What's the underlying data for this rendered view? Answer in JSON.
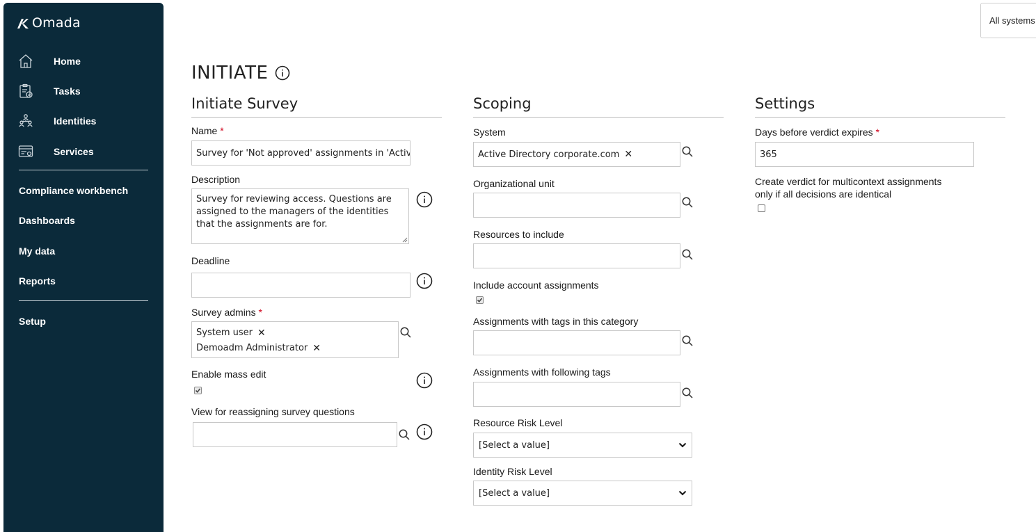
{
  "brand": {
    "name": "Omada"
  },
  "sidebar": {
    "items": [
      {
        "label": "Home",
        "icon": "home-icon"
      },
      {
        "label": "Tasks",
        "icon": "tasks-icon"
      },
      {
        "label": "Identities",
        "icon": "identities-icon"
      },
      {
        "label": "Services",
        "icon": "services-icon"
      }
    ],
    "links": [
      {
        "label": "Compliance workbench"
      },
      {
        "label": "Dashboards"
      },
      {
        "label": "My data"
      },
      {
        "label": "Reports"
      }
    ],
    "setup": "Setup"
  },
  "topbar": {
    "system_selector": "All systems"
  },
  "page": {
    "title": "INITIATE"
  },
  "initiate_survey": {
    "heading": "Initiate Survey",
    "name_label": "Name",
    "name_value": "Survey for 'Not approved' assignments in 'Active",
    "description_label": "Description",
    "description_value": "Survey for reviewing access. Questions are assigned to the managers of the identities that the assignments are for.",
    "deadline_label": "Deadline",
    "deadline_value": "",
    "survey_admins_label": "Survey admins",
    "survey_admins": [
      "System user",
      "Demoadm Administrator"
    ],
    "mass_edit_label": "Enable mass edit",
    "mass_edit_checked": true,
    "reassign_view_label": "View for reassigning survey questions",
    "reassign_view_value": ""
  },
  "scoping": {
    "heading": "Scoping",
    "system_label": "System",
    "system_tags": [
      "Active Directory corporate.com"
    ],
    "org_unit_label": "Organizational unit",
    "resources_label": "Resources to include",
    "include_account_label": "Include account assignments",
    "include_account_checked": true,
    "tag_category_label": "Assignments with tags in this category",
    "following_tags_label": "Assignments with following tags",
    "resource_risk_label": "Resource Risk Level",
    "resource_risk_value": "[Select a value]",
    "identity_risk_label": "Identity Risk Level",
    "identity_risk_value": "[Select a value]"
  },
  "settings": {
    "heading": "Settings",
    "days_label": "Days before verdict expires",
    "days_value": "365",
    "multicontext_label_1": "Create verdict for multicontext assignments",
    "multicontext_label_2": "only if all decisions are identical",
    "multicontext_checked": false
  },
  "required_marker": "*"
}
